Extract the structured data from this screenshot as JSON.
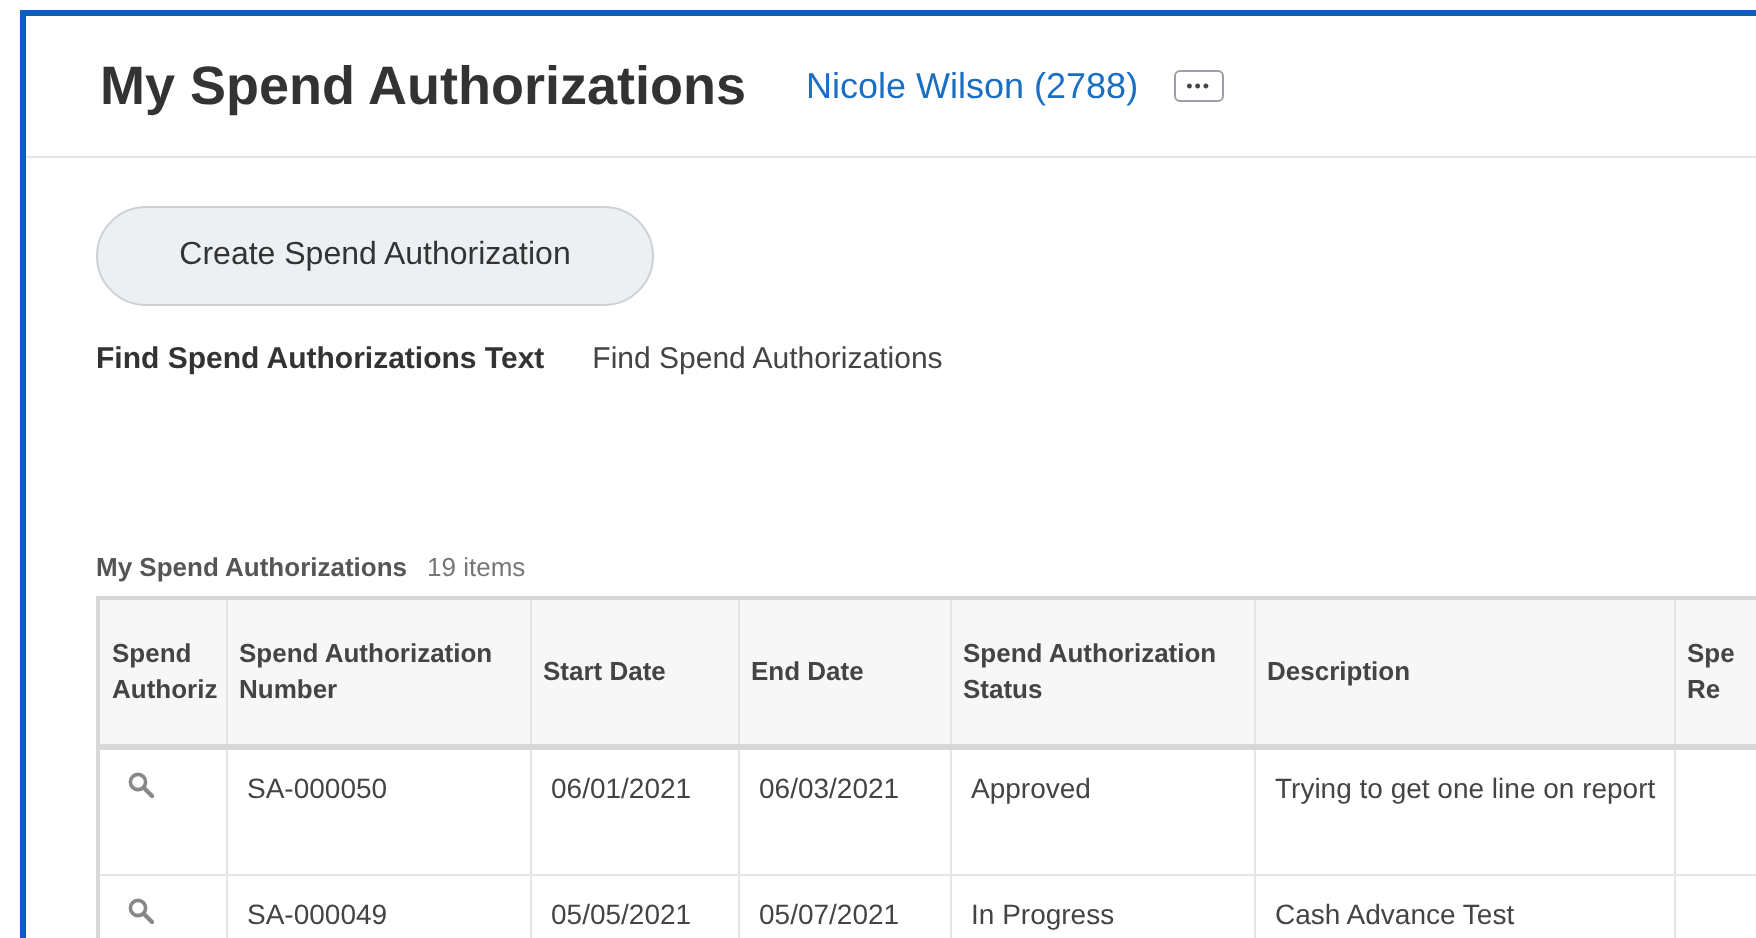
{
  "header": {
    "title": "My Spend Authorizations",
    "worker_link": "Nicole Wilson (2788)",
    "more_button": "•••"
  },
  "create_button": "Create Spend Authorization",
  "find": {
    "label": "Find Spend Authorizations Text",
    "value": "Find Spend Authorizations"
  },
  "table": {
    "title": "My Spend Authorizations",
    "count": "19 items",
    "columns": [
      {
        "lines": [
          "Spend",
          "Authoriz"
        ]
      },
      {
        "lines": [
          "Spend Authorization",
          "Number"
        ]
      },
      {
        "lines": [
          "Start Date"
        ]
      },
      {
        "lines": [
          "End Date"
        ]
      },
      {
        "lines": [
          "Spend Authorization",
          "Status"
        ]
      },
      {
        "lines": [
          "Description"
        ]
      },
      {
        "lines": [
          "Spe",
          "Re"
        ]
      }
    ],
    "rows": [
      {
        "number": "SA-000050",
        "start_date": "06/01/2021",
        "end_date": "06/03/2021",
        "status": "Approved",
        "description": "Trying to get one line on report"
      },
      {
        "number": "SA-000049",
        "start_date": "05/05/2021",
        "end_date": "05/07/2021",
        "status": "In Progress",
        "description": "Cash Advance Test"
      }
    ]
  }
}
